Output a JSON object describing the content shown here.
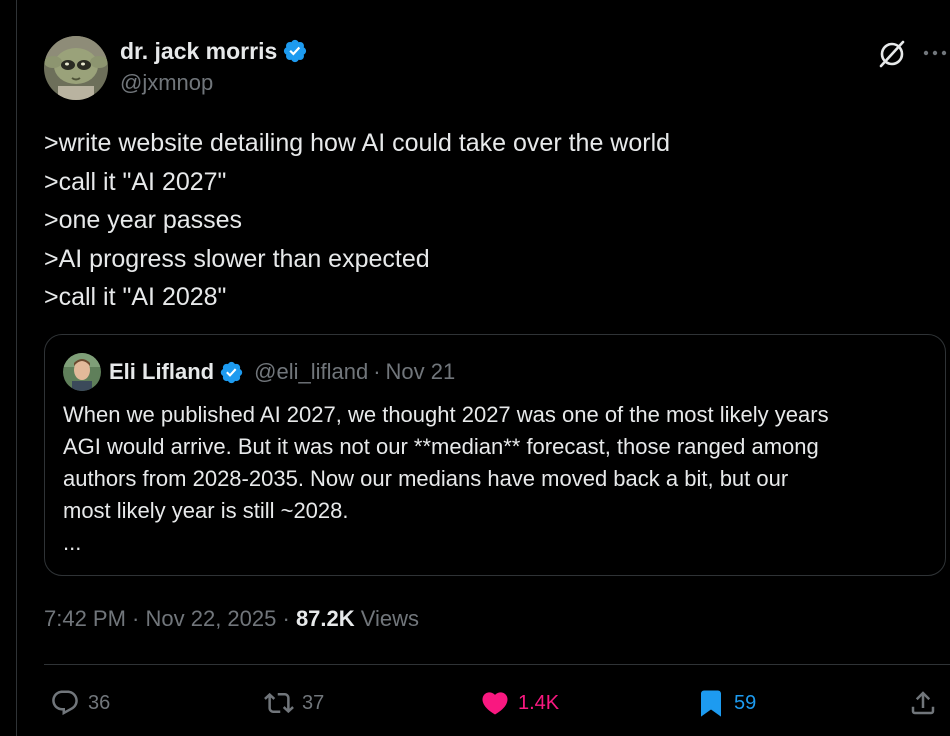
{
  "author": {
    "display_name": "dr. jack morris",
    "handle": "@jxmnop"
  },
  "header_icons": {
    "grok": "grok-icon",
    "more": "more-icon"
  },
  "tweet": {
    "lines": [
      ">write website detailing how AI could take over the world",
      ">call it \"AI 2027\"",
      ">one year passes",
      ">AI progress slower than expected",
      ">call it \"AI 2028\""
    ]
  },
  "quote": {
    "display_name": "Eli Lifland",
    "handle": "@eli_lifland",
    "separator": "·",
    "date": "Nov 21",
    "lines": [
      "When we published AI 2027, we thought 2027 was one of the most likely years",
      "AGI would arrive. But it was not our **median** forecast, those ranged among",
      "authors from 2028-2035. Now our medians have moved back a bit, but our",
      "most likely year is still ~2028.",
      "..."
    ]
  },
  "meta": {
    "time": "7:42 PM",
    "separator": " · ",
    "date": "Nov 22, 2025",
    "separator2": " · ",
    "views_count": "87.2K",
    "views_label": " Views"
  },
  "actions": {
    "replies": "36",
    "reposts": "37",
    "likes": "1.4K",
    "bookmarks": "59"
  },
  "colors": {
    "background": "#000000",
    "text": "#e7e9ea",
    "secondary": "#71767b",
    "border": "#2f3336",
    "verified": "#1d9bf0",
    "like": "#f91880",
    "bookmark": "#1d9bf0"
  }
}
